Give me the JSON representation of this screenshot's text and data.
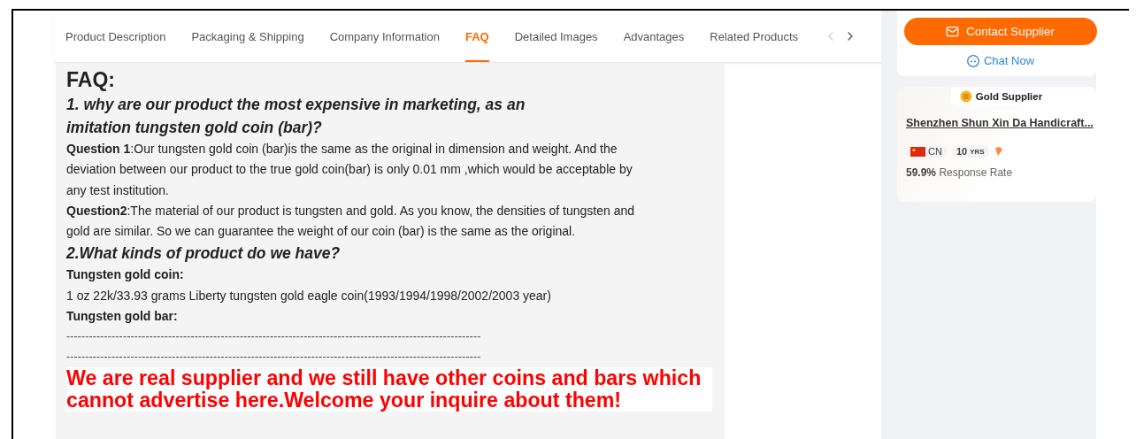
{
  "tabs": [
    {
      "label": "Product Description",
      "selected": false
    },
    {
      "label": "Packaging & Shipping",
      "selected": false
    },
    {
      "label": "Company Information",
      "selected": false
    },
    {
      "label": "FAQ",
      "selected": true
    },
    {
      "label": "Detailed Images",
      "selected": false
    },
    {
      "label": "Advantages",
      "selected": false
    },
    {
      "label": "Related Products",
      "selected": false
    }
  ],
  "tab_scroll": [
    {
      "kind": "prev",
      "disabled": true
    },
    {
      "kind": "next",
      "disabled": false
    }
  ],
  "faq": {
    "title": "FAQ:",
    "blocks": [
      {
        "kind": "heading",
        "text": "1. why are our product the most expensive in marketing, as an imitation tungsten gold coin (bar)?"
      },
      {
        "kind": "paragraph",
        "text": "**Question 1**:Our tungsten gold coin (bar)is the same as the original in dimension and weight. And the deviation between our product to the true gold coin(bar) is only 0.01 mm ,which would be acceptable by any test institution."
      },
      {
        "kind": "paragraph",
        "text": "**Question2**:The material of our product is tungsten and gold. As you know, the densities of tungsten and gold are similar. So we can guarantee the weight of our coin (bar) is the same as the original."
      },
      {
        "kind": "heading",
        "text": "2.What kinds of product do we have?"
      },
      {
        "kind": "label",
        "text": "Tungsten gold coin:"
      },
      {
        "kind": "paragraph",
        "text": "1 oz 22k/33.93 grams Liberty tungsten gold eagle coin(1993/1994/1998/2002/2003 year)"
      },
      {
        "kind": "label",
        "text": "Tungsten gold bar:"
      },
      {
        "kind": "rule",
        "text": "--------------------------------------------------------------------------------------------------------------"
      },
      {
        "kind": "rule",
        "text": "--------------------------------------------------------------------------------------------------------------"
      },
      {
        "kind": "notice",
        "text": "We are real supplier and we still have other coins and bars which cannot advertise here.Welcome your inquire about them!"
      }
    ]
  },
  "contact": {
    "button": "Contact Supplier",
    "chat": "Chat Now"
  },
  "supplier": {
    "badge": "Gold Supplier",
    "name": "Shenzhen Shun Xin Da Handicraft...",
    "country": "CN",
    "years": "10",
    "years_unit": "YRS",
    "response_rate": "59.9%",
    "response_label": "Response Rate"
  }
}
